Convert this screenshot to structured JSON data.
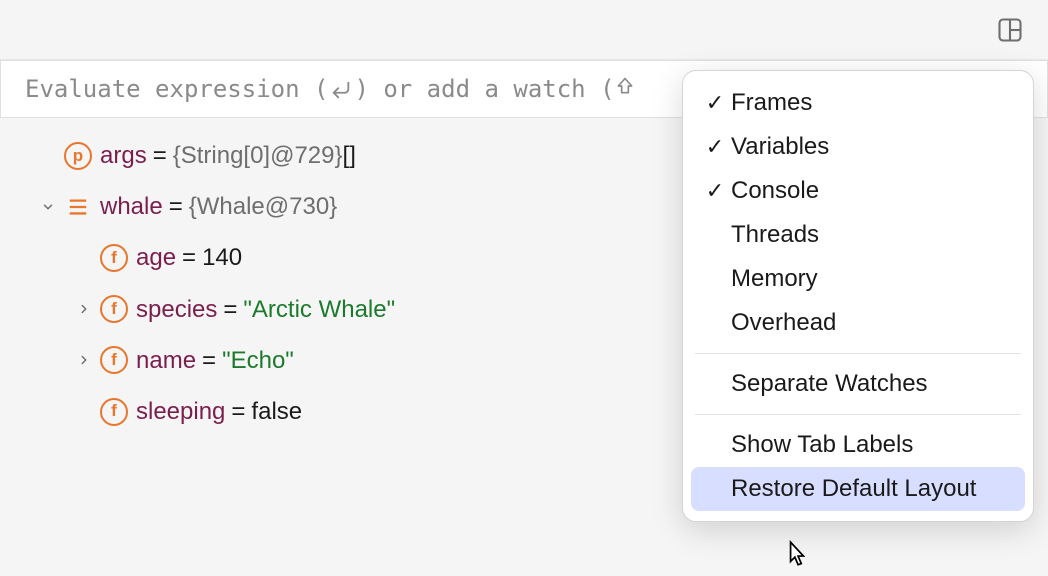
{
  "expressionBar": {
    "placeholderPrefix": "Evaluate expression (",
    "placeholderMid": ") or add a watch (",
    "enterGlyph": "↵",
    "shiftGlyph": "⇧"
  },
  "variables": [
    {
      "row": "args",
      "iconType": "p",
      "name": "args",
      "sep": " = ",
      "valueRef": "{String[0]@729} ",
      "valueSuffix": "[]",
      "suffixClass": "plain",
      "indent": 0,
      "chevron": null
    },
    {
      "row": "whale",
      "iconType": "obj",
      "name": "whale",
      "sep": " = ",
      "valueRef": "{Whale@730}",
      "valueSuffix": "",
      "suffixClass": "plain",
      "indent": 0,
      "chevron": "down"
    },
    {
      "row": "age",
      "iconType": "f",
      "name": "age",
      "sep": " = ",
      "valueRef": "",
      "valueSuffix": "140",
      "suffixClass": "plain",
      "indent": 1,
      "chevron": null
    },
    {
      "row": "species",
      "iconType": "f",
      "name": "species",
      "sep": " = ",
      "valueRef": "",
      "valueSuffix": "\"Arctic Whale\"",
      "suffixClass": "str",
      "indent": 1,
      "chevron": "right"
    },
    {
      "row": "name",
      "iconType": "f",
      "name": "name",
      "sep": " = ",
      "valueRef": "",
      "valueSuffix": "\"Echo\"",
      "suffixClass": "str",
      "indent": 1,
      "chevron": "right"
    },
    {
      "row": "sleeping",
      "iconType": "f",
      "name": "sleeping",
      "sep": " = ",
      "valueRef": "",
      "valueSuffix": "false",
      "suffixClass": "plain",
      "indent": 1,
      "chevron": null
    }
  ],
  "menu": {
    "groups": [
      [
        {
          "label": "Frames",
          "checked": true,
          "hover": false
        },
        {
          "label": "Variables",
          "checked": true,
          "hover": false
        },
        {
          "label": "Console",
          "checked": true,
          "hover": false
        },
        {
          "label": "Threads",
          "checked": false,
          "hover": false
        },
        {
          "label": "Memory",
          "checked": false,
          "hover": false
        },
        {
          "label": "Overhead",
          "checked": false,
          "hover": false
        }
      ],
      [
        {
          "label": "Separate Watches",
          "checked": false,
          "hover": false
        }
      ],
      [
        {
          "label": "Show Tab Labels",
          "checked": false,
          "hover": false
        },
        {
          "label": "Restore Default Layout",
          "checked": false,
          "hover": true
        }
      ]
    ]
  },
  "icons": {
    "p": "p",
    "f": "f",
    "check": "✓"
  },
  "colors": {
    "iconOrange": "#e8762d",
    "varName": "#7a1f4d",
    "strGreen": "#1d7a2d",
    "menuHover": "#d8deff"
  }
}
